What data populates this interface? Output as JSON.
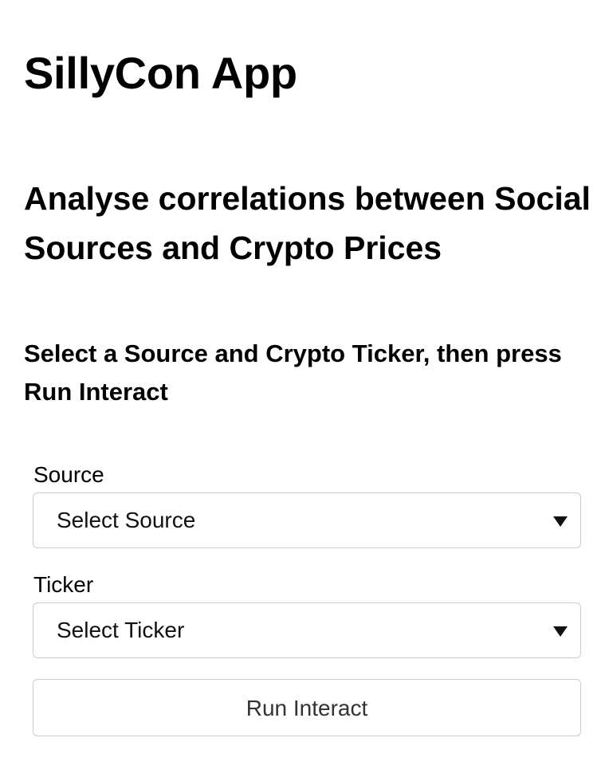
{
  "header": {
    "app_title": "SillyCon App",
    "subtitle": "Analyse correlations between Social Sources and Crypto Prices",
    "instructions": "Select a Source and Crypto Ticker, then press Run Interact"
  },
  "form": {
    "source": {
      "label": "Source",
      "selected": "Select Source",
      "icon": "caret-down-icon"
    },
    "ticker": {
      "label": "Ticker",
      "selected": "Select Ticker",
      "icon": "caret-down-icon"
    },
    "run_button_label": "Run Interact"
  },
  "colors": {
    "text": "#000000",
    "border": "#cccccc",
    "button_text": "#333333",
    "background": "#ffffff"
  }
}
